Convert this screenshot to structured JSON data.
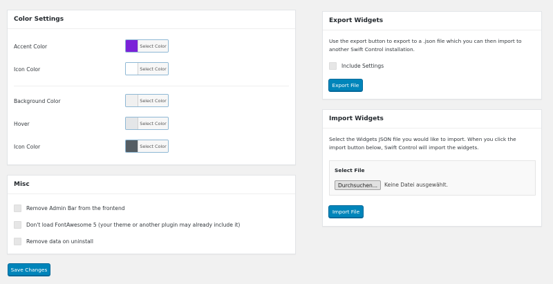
{
  "color_settings": {
    "title": "Color Settings",
    "rows": [
      {
        "label": "Accent Color",
        "button": "Select Color",
        "swatch": "#7b22d8"
      },
      {
        "label": "Icon Color",
        "button": "Select Color",
        "swatch": "#ffffff"
      },
      {
        "label": "Background Color",
        "button": "Select Color",
        "swatch": "#f0f0f0"
      },
      {
        "label": "Hover",
        "button": "Select Color",
        "swatch": "#e4e6e8"
      },
      {
        "label": "Icon Color",
        "button": "Select Color",
        "swatch": "#555d63"
      }
    ]
  },
  "misc": {
    "title": "Misc",
    "options": [
      {
        "label": "Remove Admin Bar from the frontend",
        "checked": false
      },
      {
        "label": "Don't load FontAwesome 5 (your theme or another plugin may already include it)",
        "checked": false
      },
      {
        "label": "Remove data on uninstall",
        "checked": false
      }
    ]
  },
  "save_button": "Save Changes",
  "export": {
    "title": "Export Widgets",
    "description": "Use the export button to export to a .json file which you can then import to another Swift Control installation.",
    "include_settings_label": "Include Settings",
    "include_settings_checked": false,
    "button": "Export File"
  },
  "import": {
    "title": "Import Widgets",
    "description": "Select the Widgets JSON file you would like to import. When you click the import button below, Swift Control will import the widgets.",
    "select_file_label": "Select File",
    "browse_button": "Durchsuchen...",
    "file_status": "Keine Datei ausgewählt.",
    "button": "Import File"
  },
  "colors": {
    "primary": "#0085ba",
    "background": "#f1f1f1"
  }
}
